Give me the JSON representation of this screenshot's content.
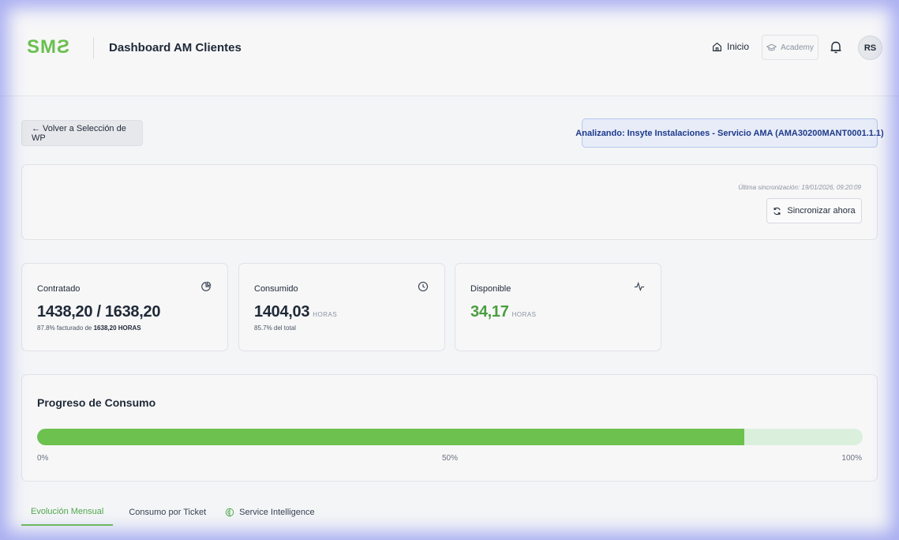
{
  "header": {
    "logo": "SMƧ",
    "title": "Dashboard AM Clientes",
    "nav_home": "Inicio",
    "nav_academy": "Academy",
    "avatar_initials": "RS"
  },
  "toolbar": {
    "back_label": "← Volver a Selección de WP",
    "analyzing_label": "Analizando: Insyte Instalaciones - Servicio AMA (AMA30200MANT0001.1.1)"
  },
  "sync": {
    "last_sync": "Última sincronización: 19/01/2026, 09:20:09",
    "button_label": "Sincronizar ahora"
  },
  "stats": {
    "contratado": {
      "label": "Contratado",
      "value": "1438,20 / 1638,20",
      "sub_prefix": "87.8% facturado de ",
      "sub_bold": "1638,20 HORAS"
    },
    "consumido": {
      "label": "Consumido",
      "value": "1404,03",
      "unit": "HORAS",
      "sub": "85.7% del total"
    },
    "disponible": {
      "label": "Disponible",
      "value": "34,17",
      "unit": "HORAS"
    }
  },
  "progress": {
    "title": "Progreso de Consumo",
    "percent": 85.7,
    "tick_start": "0%",
    "tick_mid": "50%",
    "tick_end": "100%"
  },
  "tabs": [
    {
      "label": "Evolución Mensual",
      "active": true
    },
    {
      "label": "Consumo por Ticket",
      "active": false
    },
    {
      "label": "Service Intelligence",
      "active": false
    }
  ],
  "colors": {
    "accent_green": "#6cc14f",
    "track_green": "#dbefdd",
    "info_blue": "#1e3a8a"
  }
}
